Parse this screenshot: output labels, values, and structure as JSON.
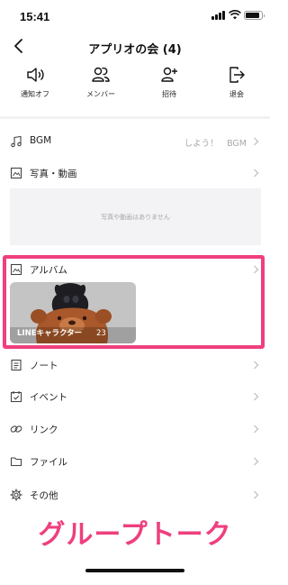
{
  "status": {
    "time": "15:41"
  },
  "header": {
    "title": "アプリオの会 (4)"
  },
  "actions": [
    {
      "icon": "speaker-mute-icon",
      "label": "通知オフ"
    },
    {
      "icon": "members-icon",
      "label": "メンバー"
    },
    {
      "icon": "invite-icon",
      "label": "招待"
    },
    {
      "icon": "leave-icon",
      "label": "退会"
    }
  ],
  "menu": {
    "bgm": {
      "label": "BGM",
      "value": "しよう！　BGM"
    },
    "media": {
      "label": "写真・動画",
      "empty_text": "写真や動画はありません"
    },
    "album": {
      "label": "アルバム",
      "thumb_title": "LINEキャラクター",
      "thumb_count": "23"
    },
    "note": {
      "label": "ノート"
    },
    "event": {
      "label": "イベント"
    },
    "link": {
      "label": "リンク"
    },
    "file": {
      "label": "ファイル"
    },
    "other": {
      "label": "その他"
    }
  },
  "caption": "グループトーク",
  "colors": {
    "highlight": "#ef3f7f",
    "muted_text": "#a9a9ae",
    "section_gap": "#f1f1f3"
  }
}
